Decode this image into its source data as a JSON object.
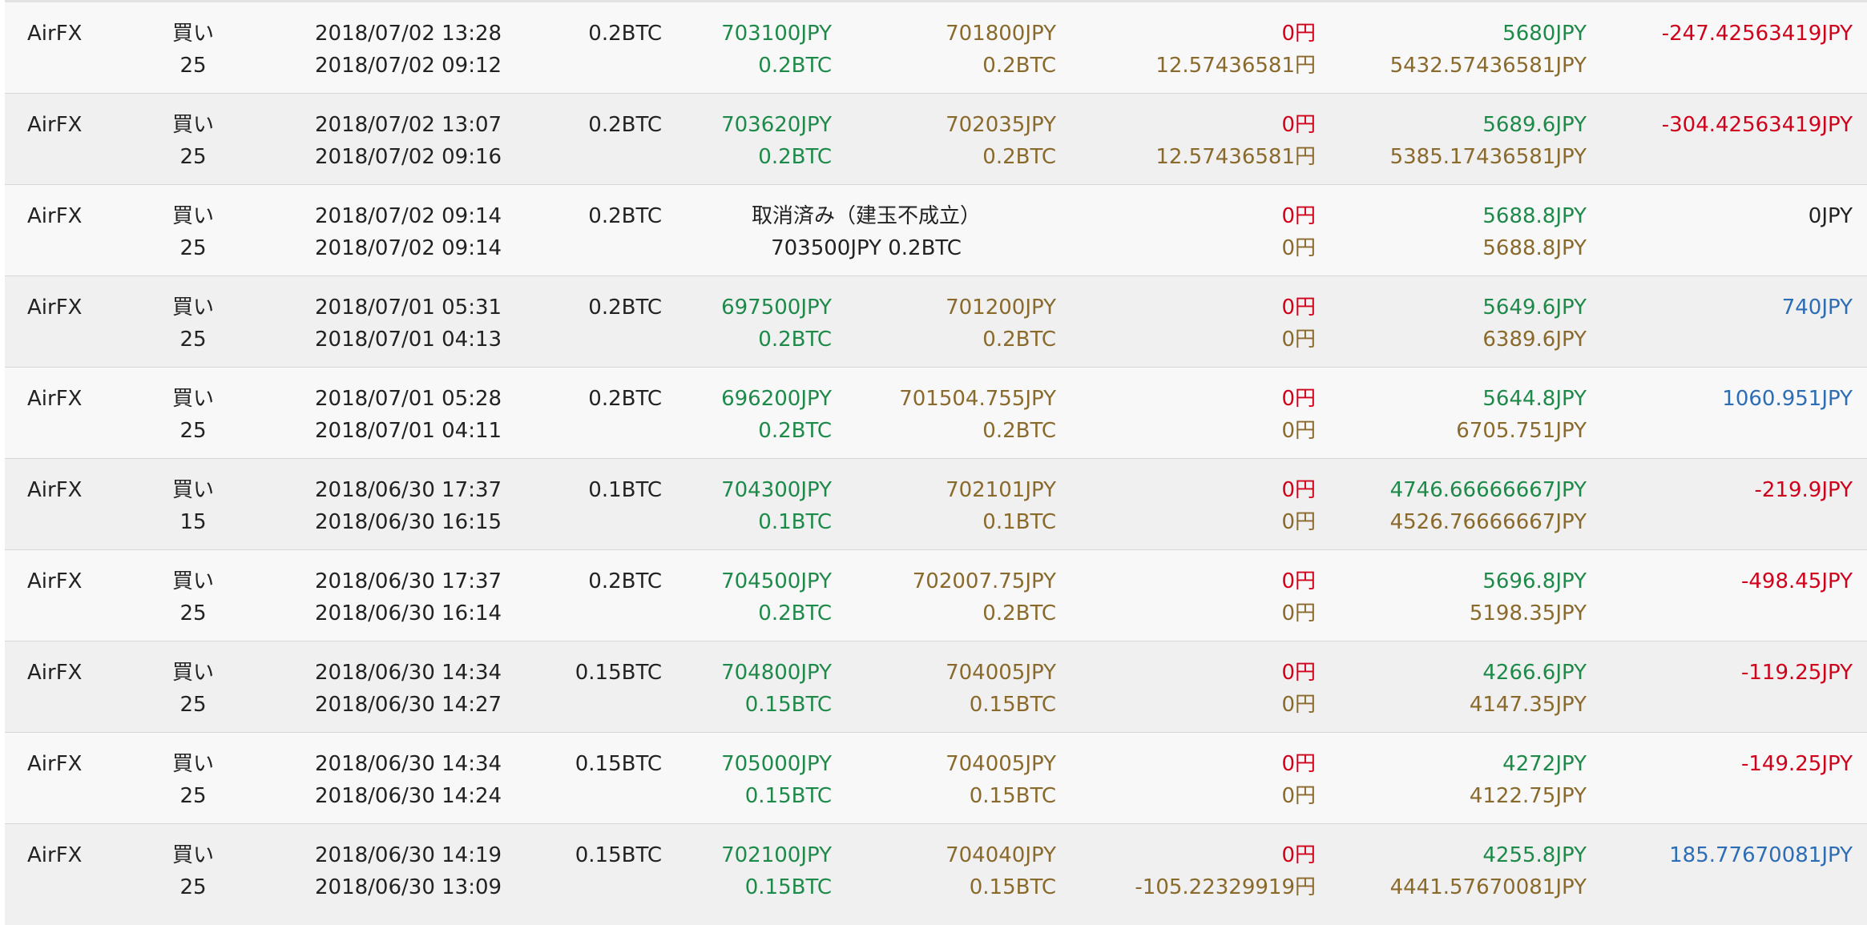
{
  "colors": {
    "text": "#222222",
    "open_price": "#1e8a4a",
    "close_price": "#8a6a2c",
    "fee_top": "#d0021b",
    "loss": "#d0021b",
    "profit": "#2d6db5",
    "row_odd": "#f8f8f8",
    "row_even": "#f0f0f0"
  },
  "rows": [
    {
      "exchange": "AirFX",
      "side": "買い",
      "leverage": "25",
      "date_close": "2018/07/02 13:28",
      "date_open": "2018/07/02 09:12",
      "size": "0.2BTC",
      "open_price": "703100JPY",
      "open_size": "0.2BTC",
      "close_price": "701800JPY",
      "close_size": "0.2BTC",
      "fee1": "0円",
      "fee2": "12.57436581円",
      "margin1": "5680JPY",
      "margin2": "5432.57436581JPY",
      "pnl": "-247.42563419JPY",
      "pnl_class": "red"
    },
    {
      "exchange": "AirFX",
      "side": "買い",
      "leverage": "25",
      "date_close": "2018/07/02 13:07",
      "date_open": "2018/07/02 09:16",
      "size": "0.2BTC",
      "open_price": "703620JPY",
      "open_size": "0.2BTC",
      "close_price": "702035JPY",
      "close_size": "0.2BTC",
      "fee1": "0円",
      "fee2": "12.57436581円",
      "margin1": "5689.6JPY",
      "margin2": "5385.17436581JPY",
      "pnl": "-304.42563419JPY",
      "pnl_class": "red"
    },
    {
      "exchange": "AirFX",
      "side": "買い",
      "leverage": "25",
      "date_close": "2018/07/02 09:14",
      "date_open": "2018/07/02 09:14",
      "size": "0.2BTC",
      "cancel_line1": "取消済み（建玉不成立）",
      "cancel_line2": "703500JPY 0.2BTC",
      "fee1": "0円",
      "fee2": "0円",
      "margin1": "5688.8JPY",
      "margin2": "5688.8JPY",
      "pnl": "0JPY",
      "pnl_class": "dark"
    },
    {
      "exchange": "AirFX",
      "side": "買い",
      "leverage": "25",
      "date_close": "2018/07/01 05:31",
      "date_open": "2018/07/01 04:13",
      "size": "0.2BTC",
      "open_price": "697500JPY",
      "open_size": "0.2BTC",
      "close_price": "701200JPY",
      "close_size": "0.2BTC",
      "fee1": "0円",
      "fee2": "0円",
      "margin1": "5649.6JPY",
      "margin2": "6389.6JPY",
      "pnl": "740JPY",
      "pnl_class": "blue"
    },
    {
      "exchange": "AirFX",
      "side": "買い",
      "leverage": "25",
      "date_close": "2018/07/01 05:28",
      "date_open": "2018/07/01 04:11",
      "size": "0.2BTC",
      "open_price": "696200JPY",
      "open_size": "0.2BTC",
      "close_price": "701504.755JPY",
      "close_size": "0.2BTC",
      "fee1": "0円",
      "fee2": "0円",
      "margin1": "5644.8JPY",
      "margin2": "6705.751JPY",
      "pnl": "1060.951JPY",
      "pnl_class": "blue"
    },
    {
      "exchange": "AirFX",
      "side": "買い",
      "leverage": "15",
      "date_close": "2018/06/30 17:37",
      "date_open": "2018/06/30 16:15",
      "size": "0.1BTC",
      "open_price": "704300JPY",
      "open_size": "0.1BTC",
      "close_price": "702101JPY",
      "close_size": "0.1BTC",
      "fee1": "0円",
      "fee2": "0円",
      "margin1": "4746.66666667JPY",
      "margin2": "4526.76666667JPY",
      "pnl": "-219.9JPY",
      "pnl_class": "red"
    },
    {
      "exchange": "AirFX",
      "side": "買い",
      "leverage": "25",
      "date_close": "2018/06/30 17:37",
      "date_open": "2018/06/30 16:14",
      "size": "0.2BTC",
      "open_price": "704500JPY",
      "open_size": "0.2BTC",
      "close_price": "702007.75JPY",
      "close_size": "0.2BTC",
      "fee1": "0円",
      "fee2": "0円",
      "margin1": "5696.8JPY",
      "margin2": "5198.35JPY",
      "pnl": "-498.45JPY",
      "pnl_class": "red"
    },
    {
      "exchange": "AirFX",
      "side": "買い",
      "leverage": "25",
      "date_close": "2018/06/30 14:34",
      "date_open": "2018/06/30 14:27",
      "size": "0.15BTC",
      "open_price": "704800JPY",
      "open_size": "0.15BTC",
      "close_price": "704005JPY",
      "close_size": "0.15BTC",
      "fee1": "0円",
      "fee2": "0円",
      "margin1": "4266.6JPY",
      "margin2": "4147.35JPY",
      "pnl": "-119.25JPY",
      "pnl_class": "red"
    },
    {
      "exchange": "AirFX",
      "side": "買い",
      "leverage": "25",
      "date_close": "2018/06/30 14:34",
      "date_open": "2018/06/30 14:24",
      "size": "0.15BTC",
      "open_price": "705000JPY",
      "open_size": "0.15BTC",
      "close_price": "704005JPY",
      "close_size": "0.15BTC",
      "fee1": "0円",
      "fee2": "0円",
      "margin1": "4272JPY",
      "margin2": "4122.75JPY",
      "pnl": "-149.25JPY",
      "pnl_class": "red"
    },
    {
      "exchange": "AirFX",
      "side": "買い",
      "leverage": "25",
      "date_close": "2018/06/30 14:19",
      "date_open": "2018/06/30 13:09",
      "size": "0.15BTC",
      "open_price": "702100JPY",
      "open_size": "0.15BTC",
      "close_price": "704040JPY",
      "close_size": "0.15BTC",
      "fee1": "0円",
      "fee2": "-105.22329919円",
      "margin1": "4255.8JPY",
      "margin2": "4441.57670081JPY",
      "pnl": "185.77670081JPY",
      "pnl_class": "blue"
    }
  ]
}
